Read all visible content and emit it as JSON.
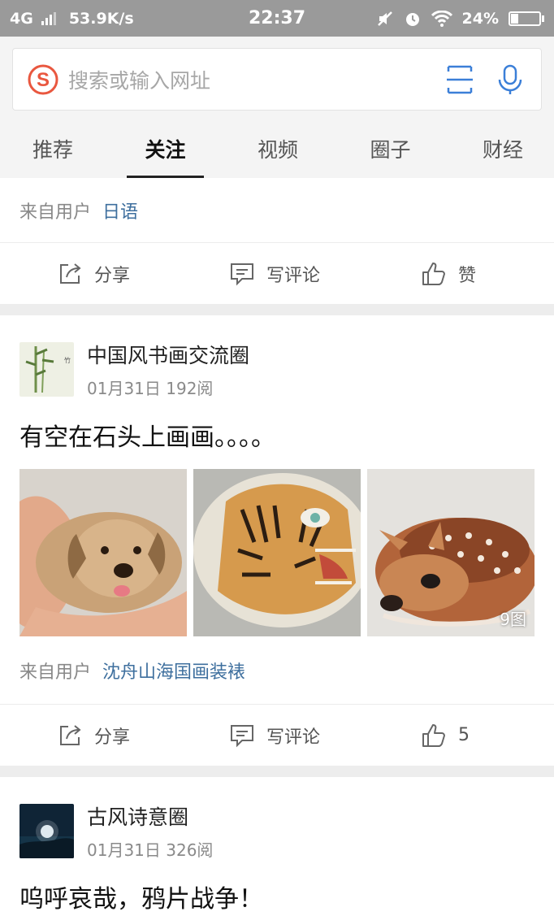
{
  "status_bar": {
    "network": "4G",
    "speed": "53.9K/s",
    "time": "22:37",
    "battery": "24%",
    "battery_level": 0.24
  },
  "search": {
    "placeholder": "搜索或输入网址"
  },
  "tabs": [
    {
      "label": "推荐",
      "active": false
    },
    {
      "label": "关注",
      "active": true
    },
    {
      "label": "视频",
      "active": false
    },
    {
      "label": "圈子",
      "active": false
    },
    {
      "label": "财经",
      "active": false
    }
  ],
  "top_card": {
    "from_label": "来自用户",
    "from_user": "日语",
    "share": "分享",
    "comment": "写评论",
    "like": "赞"
  },
  "post1": {
    "circle": "中国风书画交流圈",
    "meta": "01月31日 192阅",
    "title": "有空在石头上画画。。。。",
    "images": [
      {
        "name": "puppy-stone-painting"
      },
      {
        "name": "tiger-stone-painting"
      },
      {
        "name": "deer-stone-painting"
      }
    ],
    "image_count_badge": "9图",
    "from_label": "来自用户",
    "from_user": "沈舟山海国画装裱",
    "share": "分享",
    "comment": "写评论",
    "like": "5"
  },
  "post2": {
    "circle": "古风诗意圈",
    "meta": "01月31日 326阅",
    "title": "呜呼哀哉，鸦片战争！"
  }
}
